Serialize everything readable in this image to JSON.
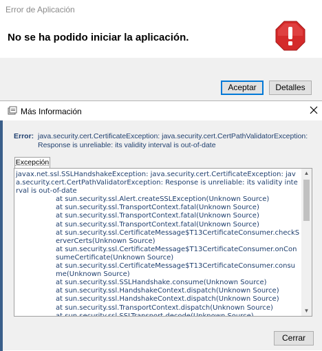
{
  "error_dialog": {
    "title": "Error de Aplicación",
    "message": "No se ha podido iniciar la aplicación.",
    "icon": "stop-icon",
    "accept_label": "Aceptar",
    "details_label": "Detalles"
  },
  "info_dialog": {
    "title": "Más Información",
    "error_label": "Error:",
    "error_text": "java.security.cert.CertificateException: java.security.cert.CertPathValidatorException: Response is unreliable: its validity interval is out-of-date",
    "tab_label": "Excepción",
    "trace_lines": [
      "javax.net.ssl.SSLHandshakeException: java.security.cert.CertificateException: java.security.cert.CertPathValidatorException: Response is unreliable: its validity interval is out-of-date",
      "\tat sun.security.ssl.Alert.createSSLException(Unknown Source)",
      "\tat sun.security.ssl.TransportContext.fatal(Unknown Source)",
      "\tat sun.security.ssl.TransportContext.fatal(Unknown Source)",
      "\tat sun.security.ssl.TransportContext.fatal(Unknown Source)",
      "\tat sun.security.ssl.CertificateMessage$T13CertificateConsumer.checkServerCerts(Unknown Source)",
      "\tat sun.security.ssl.CertificateMessage$T13CertificateConsumer.onConsumeCertificate(Unknown Source)",
      "\tat sun.security.ssl.CertificateMessage$T13CertificateConsumer.consume(Unknown Source)",
      "\tat sun.security.ssl.SSLHandshake.consume(Unknown Source)",
      "\tat sun.security.ssl.HandshakeContext.dispatch(Unknown Source)",
      "\tat sun.security.ssl.HandshakeContext.dispatch(Unknown Source)",
      "\tat sun.security.ssl.TransportContext.dispatch(Unknown Source)",
      "\tat sun.security.ssl.SSLTransport.decode(Unknown Source)"
    ],
    "close_label": "Cerrar"
  }
}
